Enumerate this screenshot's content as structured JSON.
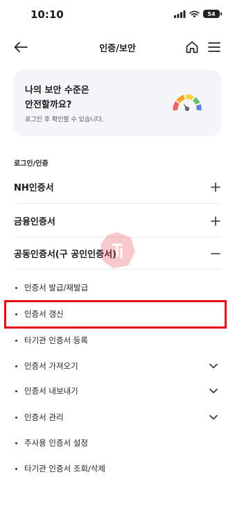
{
  "status_bar": {
    "time": "10:10",
    "battery": "54"
  },
  "header": {
    "title": "인증/보안"
  },
  "security_card": {
    "title": "나의 보안 수준은\n안전할까요?",
    "subtitle": "로그인 후 확인할 수 있습니다."
  },
  "section": {
    "label": "로그인/인증"
  },
  "accordion": [
    {
      "label": "NH인증서",
      "toggle": "plus"
    },
    {
      "label": "금융인증서",
      "toggle": "plus"
    },
    {
      "label": "공동인증서(구 공인인증서)",
      "toggle": "minus"
    }
  ],
  "sub_items": [
    {
      "label": "인증서 발급/재발급",
      "chevron": false
    },
    {
      "label": "인증서 갱신",
      "chevron": false,
      "highlighted": true
    },
    {
      "label": "타기관 인증서 등록",
      "chevron": false
    },
    {
      "label": "인증서 가져오기",
      "chevron": true
    },
    {
      "label": "인증서 내보내기",
      "chevron": true
    },
    {
      "label": "인증서 관리",
      "chevron": true
    },
    {
      "label": "주사용 인증서 설정",
      "chevron": false
    },
    {
      "label": "타기관 인증서 조회/삭제",
      "chevron": false
    }
  ],
  "colors": {
    "highlight": "#e60012",
    "card_bg": "#f4f5f9",
    "watermark": "#e8404a"
  }
}
